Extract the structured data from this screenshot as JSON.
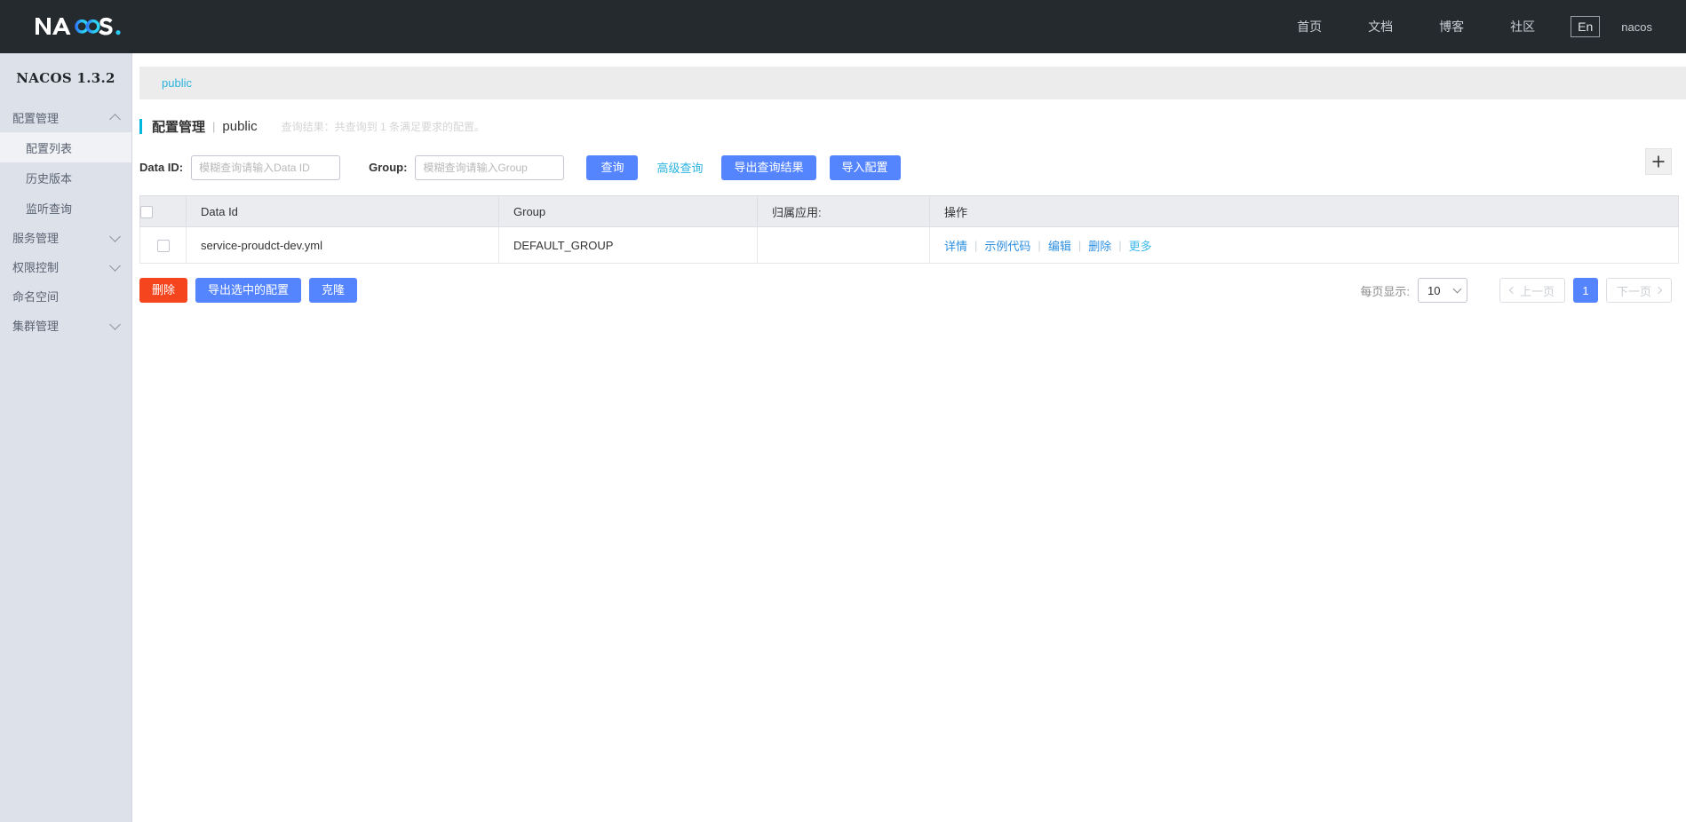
{
  "topbar": {
    "brand": "NACOS.",
    "nav": [
      {
        "label": "首页",
        "name": "nav-home"
      },
      {
        "label": "文档",
        "name": "nav-docs"
      },
      {
        "label": "博客",
        "name": "nav-blog"
      },
      {
        "label": "社区",
        "name": "nav-community"
      }
    ],
    "language": "En",
    "user": "nacos"
  },
  "sidebar": {
    "title": "NACOS 1.3.2",
    "groups": [
      {
        "label": "配置管理",
        "expanded": true,
        "items": [
          {
            "label": "配置列表",
            "active": true
          },
          {
            "label": "历史版本",
            "active": false
          },
          {
            "label": "监听查询",
            "active": false
          }
        ]
      },
      {
        "label": "服务管理",
        "expanded": false,
        "items": []
      },
      {
        "label": "权限控制",
        "expanded": false,
        "items": []
      },
      {
        "label": "命名空间",
        "expanded": null,
        "items": []
      },
      {
        "label": "集群管理",
        "expanded": false,
        "items": []
      }
    ]
  },
  "breadcrumb": {
    "current": "public"
  },
  "page": {
    "title": "配置管理",
    "separator": "|",
    "namespace": "public",
    "result_summary": "查询结果：共查询到 1 条满足要求的配置。"
  },
  "search": {
    "dataid_label": "Data ID:",
    "dataid_value": "",
    "dataid_placeholder": "模糊查询请输入Data ID",
    "group_label": "Group:",
    "group_value": "",
    "group_placeholder": "模糊查询请输入Group",
    "query_button": "查询",
    "advanced_link": "高级查询",
    "export_button": "导出查询结果",
    "import_button": "导入配置",
    "add_icon": "plus-icon"
  },
  "table": {
    "columns": [
      "Data Id",
      "Group",
      "归属应用:",
      "操作"
    ],
    "rows": [
      {
        "checked": false,
        "data_id": "service-proudct-dev.yml",
        "group": "DEFAULT_GROUP",
        "app": "",
        "actions": [
          "详情",
          "示例代码",
          "编辑",
          "删除",
          "更多"
        ]
      }
    ],
    "action_separator": "|"
  },
  "footer": {
    "delete_button": "删除",
    "export_selected_button": "导出选中的配置",
    "clone_button": "克隆",
    "page_size_label": "每页显示:",
    "page_size_value": "10",
    "prev_label": "上一页",
    "next_label": "下一页",
    "current_page": "1"
  },
  "colors": {
    "topbar_bg": "#252a2f",
    "sidebar_bg": "#dde1e9",
    "primary_blue": "#5584ff",
    "link_cyan": "#2bb3e0",
    "accent_cyan": "#00b7e0",
    "danger_red": "#f4451e"
  }
}
